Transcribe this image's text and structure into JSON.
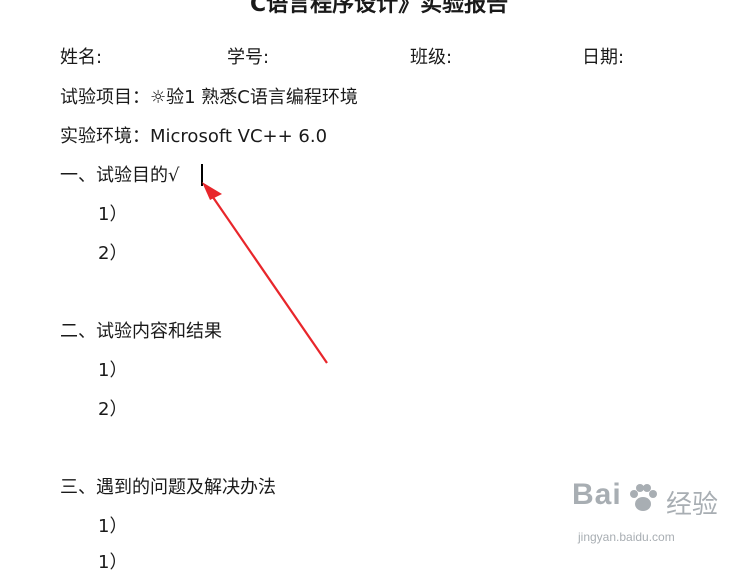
{
  "header": {
    "title_partial": "C语言程序设计》实验报告",
    "name_label": "姓名:",
    "student_id_label": "学号:",
    "class_label": "班级:",
    "date_label": "日期:"
  },
  "info": {
    "project_line": "试验项目：☼验1   熟悉C语言编程环境",
    "environment_line": "实验环境：Microsoft    VC++    6.0"
  },
  "sections": [
    {
      "heading": "一、试验目的√",
      "items": [
        "1）",
        "2）"
      ]
    },
    {
      "heading": "二、试验内容和结果",
      "items": [
        "1）",
        "2）"
      ]
    },
    {
      "heading": "三、遇到的问题及解决办法",
      "items": [
        "1）",
        "1）"
      ]
    }
  ],
  "annotation": {
    "arrow_color": "#e8262b"
  },
  "watermark": {
    "logo": "Bai",
    "logo_suffix": "经验",
    "url": "jingyan.baidu.com"
  }
}
